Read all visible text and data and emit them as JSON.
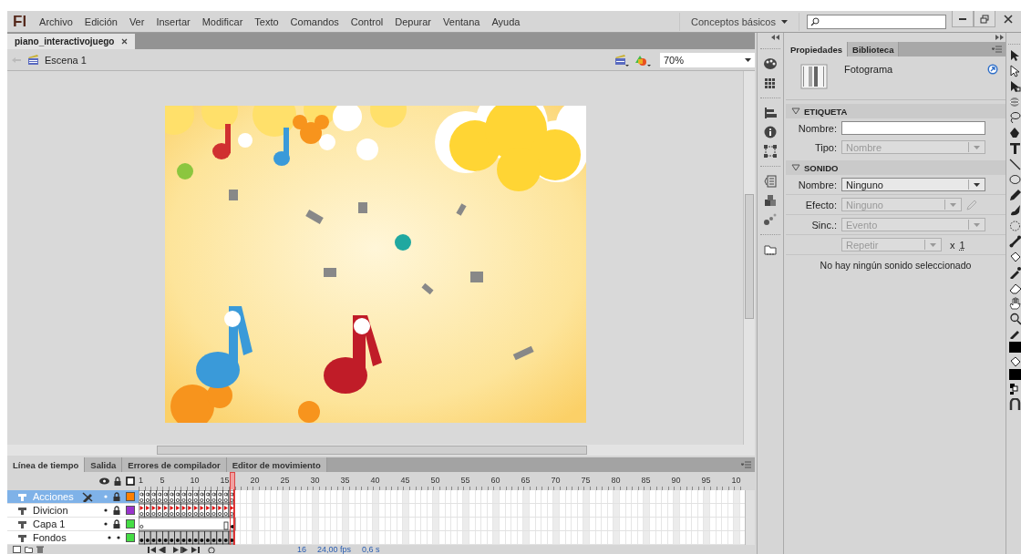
{
  "menubar": {
    "logo": "Fl",
    "menus": [
      "Archivo",
      "Edición",
      "Ver",
      "Insertar",
      "Modificar",
      "Texto",
      "Comandos",
      "Control",
      "Depurar",
      "Ventana",
      "Ayuda"
    ],
    "workspace": "Conceptos básicos"
  },
  "document_tabs": [
    {
      "label": "piano_interactivojuego",
      "selected": true
    }
  ],
  "scene_bar": {
    "scene": "Escena 1",
    "zoom": "70%"
  },
  "timeline": {
    "tabs": [
      {
        "label": "Línea de tiempo",
        "selected": true
      },
      {
        "label": "Salida",
        "selected": false
      },
      {
        "label": "Errores de compilador",
        "selected": false
      },
      {
        "label": "Editor de movimiento",
        "selected": false
      }
    ],
    "ruler": [
      "1",
      "5",
      "10",
      "15",
      "20",
      "25",
      "30",
      "35",
      "40",
      "45",
      "50",
      "55",
      "60",
      "65",
      "70",
      "75",
      "80",
      "85",
      "90",
      "95",
      "10"
    ],
    "layers": [
      {
        "name": "Acciones",
        "selected": true,
        "locked": true,
        "color": "#ff8000",
        "kind": "actions"
      },
      {
        "name": "Divicion",
        "selected": false,
        "locked": true,
        "color": "#9933cc",
        "kind": "labels"
      },
      {
        "name": "Capa 1",
        "selected": false,
        "locked": true,
        "color": "#44dd44",
        "kind": "span"
      },
      {
        "name": "Fondos",
        "selected": false,
        "locked": false,
        "color": "#44dd44",
        "kind": "keys"
      }
    ],
    "status": {
      "frame": "16",
      "fps": "24,00 fps",
      "time": "0,6 s"
    }
  },
  "properties": {
    "tabs": [
      {
        "label": "Propiedades",
        "selected": true
      },
      {
        "label": "Biblioteca",
        "selected": false
      }
    ],
    "type": "Fotograma",
    "sections": [
      {
        "title": "ETIQUETA",
        "expanded": true,
        "fields": [
          {
            "kind": "text",
            "label": "Nombre:"
          },
          {
            "kind": "select",
            "label": "Tipo:",
            "value": "Nombre",
            "disabled": true
          }
        ]
      },
      {
        "title": "SONIDO",
        "expanded": true,
        "fields": [
          {
            "kind": "select",
            "label": "Nombre:",
            "value": "Ninguno",
            "disabled": false
          },
          {
            "kind": "select_edit",
            "label": "Efecto:",
            "value": "Ninguno",
            "disabled": true
          },
          {
            "kind": "select",
            "label": "Sinc.:",
            "value": "Evento",
            "disabled": true
          },
          {
            "kind": "repeat",
            "value": "Repetir",
            "disabled": true,
            "times_label": "x",
            "times": "1"
          }
        ],
        "message": "No hay ningún sonido seleccionado"
      }
    ]
  }
}
